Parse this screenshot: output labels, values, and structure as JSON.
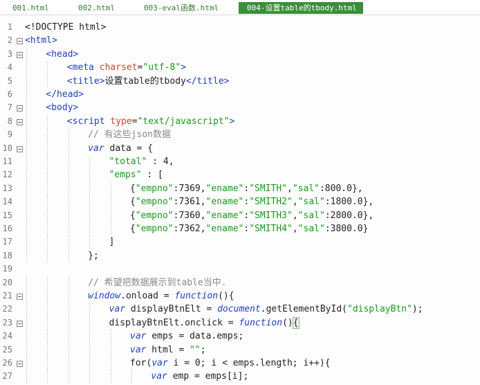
{
  "tabs": [
    {
      "label": "001.html",
      "active": false
    },
    {
      "label": "002.html",
      "active": false
    },
    {
      "label": "003-eval函数.html",
      "active": false
    },
    {
      "label": "004-设置table的tbody.html",
      "active": true
    }
  ],
  "colors": {
    "active_tab_bg": "#3a8f3a",
    "tab_text": "#2e7d32",
    "tag": "#1f3fbf",
    "attribute": "#c4472a",
    "string": "#1a9a1a",
    "comment": "#8a8a8a"
  },
  "lines": [
    {
      "n": "1",
      "fold": false,
      "indent": 0,
      "tokens": [
        {
          "t": "<!DOCTYPE html>",
          "c": "txt"
        }
      ]
    },
    {
      "n": "2",
      "fold": true,
      "indent": 0,
      "tokens": [
        {
          "t": "<html>",
          "c": "tag"
        }
      ]
    },
    {
      "n": "3",
      "fold": true,
      "indent": 1,
      "tokens": [
        {
          "t": "<head>",
          "c": "tag"
        }
      ]
    },
    {
      "n": "4",
      "fold": false,
      "indent": 2,
      "tokens": [
        {
          "t": "<meta ",
          "c": "tag"
        },
        {
          "t": "charset",
          "c": "attr"
        },
        {
          "t": "=",
          "c": "punc"
        },
        {
          "t": "\"utf-8\"",
          "c": "str"
        },
        {
          "t": ">",
          "c": "tag"
        }
      ]
    },
    {
      "n": "5",
      "fold": false,
      "indent": 2,
      "tokens": [
        {
          "t": "<title>",
          "c": "tag"
        },
        {
          "t": "设置table的tbody",
          "c": "txt"
        },
        {
          "t": "</title>",
          "c": "tag"
        }
      ]
    },
    {
      "n": "6",
      "fold": false,
      "indent": 1,
      "tokens": [
        {
          "t": "</head>",
          "c": "tag"
        }
      ]
    },
    {
      "n": "7",
      "fold": true,
      "indent": 1,
      "tokens": [
        {
          "t": "<body>",
          "c": "tag"
        }
      ]
    },
    {
      "n": "8",
      "fold": true,
      "indent": 2,
      "tokens": [
        {
          "t": "<script ",
          "c": "tag"
        },
        {
          "t": "type",
          "c": "attr"
        },
        {
          "t": "=",
          "c": "punc"
        },
        {
          "t": "\"text/javascript\"",
          "c": "str"
        },
        {
          "t": ">",
          "c": "tag"
        }
      ]
    },
    {
      "n": "9",
      "fold": false,
      "indent": 3,
      "tokens": [
        {
          "t": "// 有这些json数据",
          "c": "cmt"
        }
      ]
    },
    {
      "n": "10",
      "fold": true,
      "indent": 3,
      "tokens": [
        {
          "t": "var",
          "c": "kw"
        },
        {
          "t": " data = {",
          "c": "txt"
        }
      ]
    },
    {
      "n": "11",
      "fold": false,
      "indent": 4,
      "tokens": [
        {
          "t": "\"total\"",
          "c": "str"
        },
        {
          "t": " : 4,",
          "c": "txt"
        }
      ]
    },
    {
      "n": "12",
      "fold": false,
      "indent": 4,
      "tokens": [
        {
          "t": "\"emps\"",
          "c": "str"
        },
        {
          "t": " : [",
          "c": "txt"
        }
      ]
    },
    {
      "n": "13",
      "fold": false,
      "indent": 5,
      "tokens": [
        {
          "t": "{",
          "c": "txt"
        },
        {
          "t": "\"empno\"",
          "c": "str"
        },
        {
          "t": ":7369,",
          "c": "txt"
        },
        {
          "t": "\"ename\"",
          "c": "str"
        },
        {
          "t": ":",
          "c": "txt"
        },
        {
          "t": "\"SMITH\"",
          "c": "str"
        },
        {
          "t": ",",
          "c": "txt"
        },
        {
          "t": "\"sal\"",
          "c": "str"
        },
        {
          "t": ":800.0},",
          "c": "txt"
        }
      ]
    },
    {
      "n": "14",
      "fold": false,
      "indent": 5,
      "tokens": [
        {
          "t": "{",
          "c": "txt"
        },
        {
          "t": "\"empno\"",
          "c": "str"
        },
        {
          "t": ":7361,",
          "c": "txt"
        },
        {
          "t": "\"ename\"",
          "c": "str"
        },
        {
          "t": ":",
          "c": "txt"
        },
        {
          "t": "\"SMITH2\"",
          "c": "str"
        },
        {
          "t": ",",
          "c": "txt"
        },
        {
          "t": "\"sal\"",
          "c": "str"
        },
        {
          "t": ":1800.0},",
          "c": "txt"
        }
      ]
    },
    {
      "n": "15",
      "fold": false,
      "indent": 5,
      "tokens": [
        {
          "t": "{",
          "c": "txt"
        },
        {
          "t": "\"empno\"",
          "c": "str"
        },
        {
          "t": ":7360,",
          "c": "txt"
        },
        {
          "t": "\"ename\"",
          "c": "str"
        },
        {
          "t": ":",
          "c": "txt"
        },
        {
          "t": "\"SMITH3\"",
          "c": "str"
        },
        {
          "t": ",",
          "c": "txt"
        },
        {
          "t": "\"sal\"",
          "c": "str"
        },
        {
          "t": ":2800.0},",
          "c": "txt"
        }
      ]
    },
    {
      "n": "16",
      "fold": false,
      "indent": 5,
      "tokens": [
        {
          "t": "{",
          "c": "txt"
        },
        {
          "t": "\"empno\"",
          "c": "str"
        },
        {
          "t": ":7362,",
          "c": "txt"
        },
        {
          "t": "\"ename\"",
          "c": "str"
        },
        {
          "t": ":",
          "c": "txt"
        },
        {
          "t": "\"SMITH4\"",
          "c": "str"
        },
        {
          "t": ",",
          "c": "txt"
        },
        {
          "t": "\"sal\"",
          "c": "str"
        },
        {
          "t": ":3800.0}",
          "c": "txt"
        }
      ]
    },
    {
      "n": "17",
      "fold": false,
      "indent": 4,
      "tokens": [
        {
          "t": "]",
          "c": "txt"
        }
      ]
    },
    {
      "n": "18",
      "fold": false,
      "indent": 3,
      "tokens": [
        {
          "t": "};",
          "c": "txt"
        }
      ]
    },
    {
      "n": "19",
      "fold": false,
      "indent": 0,
      "tokens": []
    },
    {
      "n": "20",
      "fold": false,
      "indent": 3,
      "tokens": [
        {
          "t": "// 希望把数据展示到table当中.",
          "c": "cmt"
        }
      ]
    },
    {
      "n": "21",
      "fold": true,
      "indent": 3,
      "tokens": [
        {
          "t": "window",
          "c": "obj"
        },
        {
          "t": ".onload = ",
          "c": "txt"
        },
        {
          "t": "function",
          "c": "kw"
        },
        {
          "t": "(){",
          "c": "txt"
        }
      ]
    },
    {
      "n": "22",
      "fold": false,
      "indent": 4,
      "tokens": [
        {
          "t": "var",
          "c": "kw"
        },
        {
          "t": " displayBtnElt = ",
          "c": "txt"
        },
        {
          "t": "document",
          "c": "obj"
        },
        {
          "t": ".getElementById(",
          "c": "txt"
        },
        {
          "t": "\"displayBtn\"",
          "c": "str"
        },
        {
          "t": ");",
          "c": "txt"
        }
      ]
    },
    {
      "n": "23",
      "fold": true,
      "indent": 4,
      "tokens": [
        {
          "t": "displayBtnElt.onclick = ",
          "c": "txt"
        },
        {
          "t": "function",
          "c": "kw"
        },
        {
          "t": "()",
          "c": "txt"
        },
        {
          "t": "{",
          "c": "txt",
          "hl": true
        }
      ]
    },
    {
      "n": "24",
      "fold": false,
      "indent": 5,
      "tokens": [
        {
          "t": "var",
          "c": "kw"
        },
        {
          "t": " emps = data.emps;",
          "c": "txt"
        }
      ]
    },
    {
      "n": "25",
      "fold": false,
      "indent": 5,
      "tokens": [
        {
          "t": "var",
          "c": "kw"
        },
        {
          "t": " html = ",
          "c": "txt"
        },
        {
          "t": "\"\"",
          "c": "str"
        },
        {
          "t": ";",
          "c": "txt"
        }
      ]
    },
    {
      "n": "26",
      "fold": true,
      "indent": 5,
      "tokens": [
        {
          "t": "for",
          "c": "txt"
        },
        {
          "t": "(",
          "c": "txt"
        },
        {
          "t": "var",
          "c": "kw"
        },
        {
          "t": " i = 0; i < emps.length; i++){",
          "c": "txt"
        }
      ]
    },
    {
      "n": "27",
      "fold": false,
      "indent": 6,
      "tokens": [
        {
          "t": "var",
          "c": "kw"
        },
        {
          "t": " emp = emps[i];",
          "c": "txt"
        }
      ]
    }
  ]
}
